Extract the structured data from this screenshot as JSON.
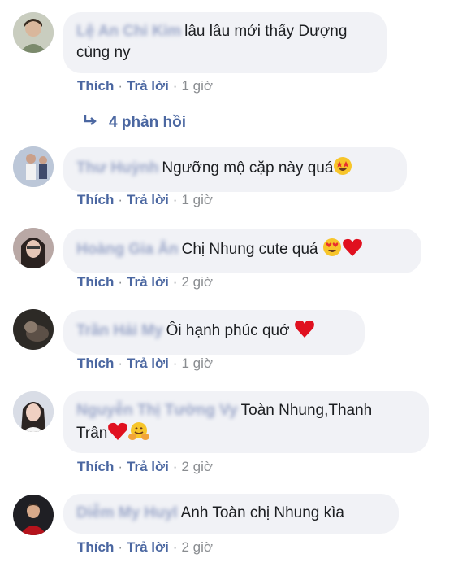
{
  "comments": [
    {
      "name": "Lệ An Chi Kim",
      "text": "lâu lâu mới thấy Dượng cùng ny",
      "like": "Thích",
      "reply": "Trả lời",
      "time": "1 giờ"
    },
    {
      "name": "Thư Huỳnh",
      "text": "Ngưỡng mộ cặp này quá",
      "like": "Thích",
      "reply": "Trả lời",
      "time": "1 giờ"
    },
    {
      "name": "Hoàng Gia Ân",
      "text": "Chị Nhung cute quá",
      "like": "Thích",
      "reply": "Trả lời",
      "time": "2 giờ"
    },
    {
      "name": "Trần Hải My",
      "text": "Ôi hạnh phúc quớ",
      "like": "Thích",
      "reply": "Trả lời",
      "time": "1 giờ"
    },
    {
      "name": "Nguyễn Thị Tường Vy",
      "text_line1": "Toàn Nhung,Thanh",
      "text_line2": "Trân",
      "like": "Thích",
      "reply": "Trả lời",
      "time": "2 giờ"
    },
    {
      "name": "Diễm My Huyl",
      "text": "Anh Toàn chị Nhung kìa",
      "like": "Thích",
      "reply": "Trả lời",
      "time": "2 giờ"
    }
  ],
  "replies_link": "4 phản hồi",
  "separator": "·",
  "icons": {
    "reply_arrow": "reply-arrow-icon",
    "star_eyes": "star-struck-emoji",
    "heart_eyes": "heart-eyes-emoji",
    "heart": "red-heart-emoji",
    "hug": "hugging-face-emoji"
  },
  "colors": {
    "link": "#4b67a1",
    "bubble": "#f1f2f6",
    "muted": "#8a8d91",
    "heart": "#e0101f"
  }
}
